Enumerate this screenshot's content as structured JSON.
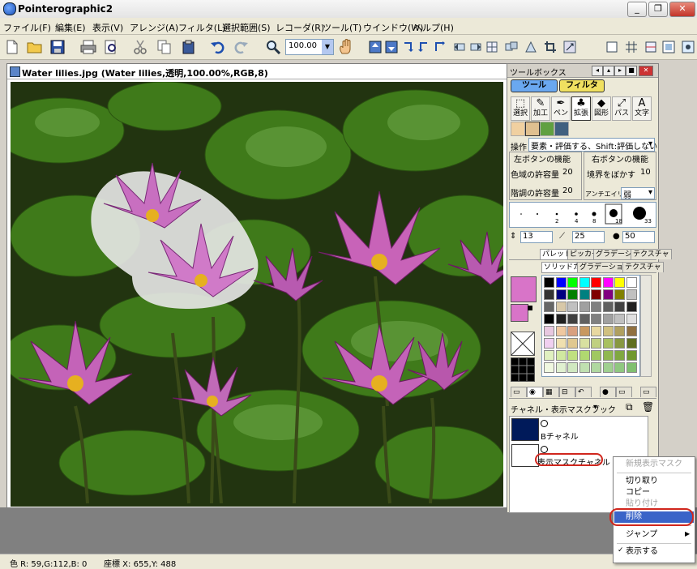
{
  "app": {
    "title": "Pointerographic2"
  },
  "menu": [
    "ファイル(F)",
    "編集(E)",
    "表示(V)",
    "アレンジ(A)",
    "フィルタ(L)",
    "選択範囲(S)",
    "レコーダ(R)",
    "ツール(T)",
    "ウインドウ(W)",
    "ヘルプ(H)"
  ],
  "toolbar": {
    "zoom_value": "100.00"
  },
  "document": {
    "title": "Water lilies.jpg (Water lilies,透明,100.00%,RGB,8)"
  },
  "toolbox": {
    "title": "ツールボックス",
    "tab_tool": "ツール",
    "tab_filter": "フィルタ",
    "tools": [
      {
        "label": "選択",
        "icon": "select-icon"
      },
      {
        "label": "加工",
        "icon": "process-icon"
      },
      {
        "label": "ペン",
        "icon": "pen-icon"
      },
      {
        "label": "拡張",
        "icon": "extend-icon"
      },
      {
        "label": "図形",
        "icon": "shape-icon"
      },
      {
        "label": "パス",
        "icon": "path-icon"
      },
      {
        "label": "文字",
        "icon": "text-icon"
      }
    ],
    "operation_label": "操作",
    "operation_value": "要素・評価する、Shift:評価しない",
    "left_button_label": "左ボタンの機能",
    "right_button_label": "右ボタンの機能",
    "color_tolerance_label": "色域の許容量",
    "color_tolerance_value": "20",
    "boundary_label": "境界をぼかす",
    "boundary_value": "10",
    "alpha_tolerance_label": "階調の許容量",
    "alpha_tolerance_value": "20",
    "antialias_label": "アンチエイリアス",
    "antialias_value": "弱",
    "brush_sizes": [
      "1",
      "2",
      "4",
      "8",
      "18",
      "33"
    ],
    "size_value": "13",
    "width_value": "25",
    "opacity_value": "50",
    "color_tabs": [
      "パレット",
      "ピッカー",
      "グラデーション",
      "テクスチャ"
    ],
    "palette_subtabs": [
      "ソリッドカラー",
      "グラデーション",
      "テクスチャ"
    ],
    "channel_dropdown": "チャネル・表示マスクブック",
    "channel_items": [
      {
        "label": "Bチャネル"
      },
      {
        "label": "表示マスクチャネル"
      }
    ]
  },
  "context_menu": {
    "items": [
      {
        "label": "新規表示マスク",
        "disabled": true
      },
      {
        "label": "切り取り",
        "disabled": false
      },
      {
        "label": "コピー",
        "disabled": false
      },
      {
        "label": "貼り付け",
        "disabled": true
      },
      {
        "label": "削除",
        "disabled": false,
        "selected": true
      },
      {
        "label": "ジャンプ",
        "disabled": false,
        "submenu": true
      },
      {
        "label": "表示する",
        "disabled": false,
        "checked": true
      }
    ]
  },
  "status": {
    "color": "色 R: 59,G:112,B: 0",
    "coords": "座標 X: 655,Y: 488"
  },
  "palette_colors": [
    "#000000",
    "#0000ff",
    "#00ff00",
    "#00ffff",
    "#ff0000",
    "#ff00ff",
    "#ffff00",
    "#ffffff",
    "#333333",
    "#000080",
    "#008000",
    "#008080",
    "#800000",
    "#800080",
    "#808000",
    "#c0c0c0",
    "#666666",
    "#d8c8a8",
    "#c0c0c0",
    "#a0a0a0",
    "#808080",
    "#606060",
    "#404040",
    "#202020",
    "#000000",
    "#202020",
    "#404040",
    "#606060",
    "#808080",
    "#a0a0a0",
    "#c0c0c0",
    "#e0e0e0",
    "#e8c8e0",
    "#f0c8a0",
    "#d8a080",
    "#c89860",
    "#e8d8a0",
    "#d0c080",
    "#b0a060",
    "#907040",
    "#f0d0f0",
    "#f0e0b0",
    "#e0c890",
    "#d8e0a0",
    "#c0d080",
    "#a8c060",
    "#889840",
    "#607020",
    "#e0f0c0",
    "#d0e8a0",
    "#c0e080",
    "#b0d870",
    "#a0c860",
    "#90b850",
    "#80a840",
    "#709830",
    "#f0f8e0",
    "#e0f0d0",
    "#d0e8c0",
    "#c0e0b0",
    "#b0d8a0",
    "#a0d090",
    "#90c880",
    "#80c070"
  ]
}
